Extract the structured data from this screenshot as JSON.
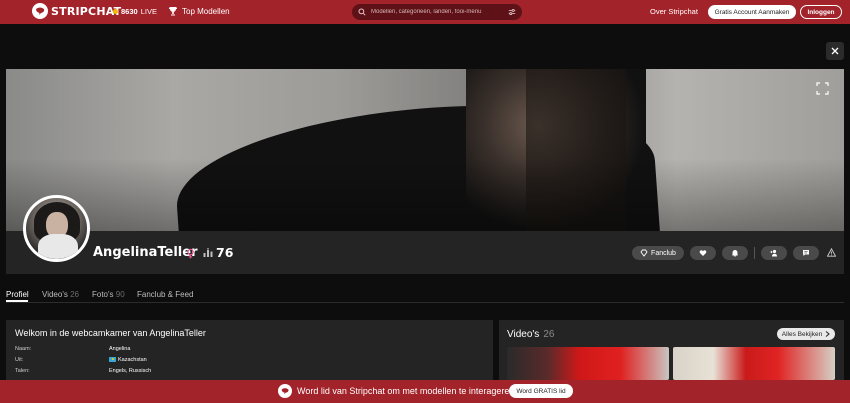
{
  "header": {
    "brand": "STRIPCHAT",
    "live_count": "8630",
    "live_label": "LIVE",
    "top_models": "Top Modellen",
    "search_placeholder": "Modellen, categorieën, landen, fooi-menu",
    "about": "Over Stripchat",
    "signup": "Gratis Account Aanmaken",
    "login": "Inloggen"
  },
  "profile": {
    "name": "AngelinaTeller",
    "rating": "76",
    "actions": {
      "fanclub": "Fanclub"
    }
  },
  "tabs": [
    {
      "label": "Profiel",
      "count": ""
    },
    {
      "label": "Video's",
      "count": "26"
    },
    {
      "label": "Foto's",
      "count": "90"
    },
    {
      "label": "Fanclub & Feed",
      "count": ""
    }
  ],
  "welcome": {
    "title": "Welkom in de webcamkamer van AngelinaTeller",
    "rows": [
      {
        "label": "Naam:",
        "value": "Angelina"
      },
      {
        "label": "Uit:",
        "value": "Kazachstan"
      },
      {
        "label": "Talen:",
        "value": "Engels, Russisch"
      }
    ]
  },
  "videos": {
    "title": "Video's",
    "count": "26",
    "view_all": "Alles Bekijken"
  },
  "banner": {
    "text": "Word lid van Stripchat om met modellen te interageren.",
    "button": "Word GRATIS lid"
  },
  "colors": {
    "brand": "#a3232b",
    "live_dot": "#f5b700",
    "panel": "#242424",
    "background": "#0d0d0d"
  }
}
